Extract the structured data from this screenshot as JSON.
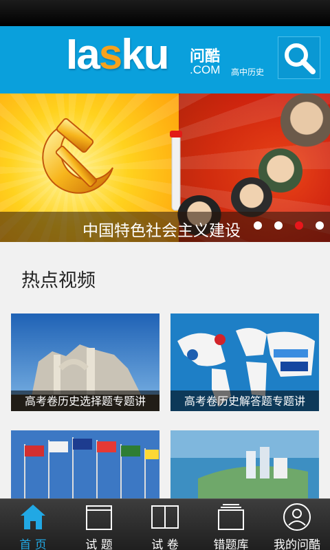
{
  "header": {
    "logo": {
      "main_a": "Ia",
      "main_q": "s",
      "main_b": "ku",
      "cn": "问酷",
      "com": ".COM",
      "subtitle": "高中历史"
    },
    "search_icon": "search-icon"
  },
  "banner": {
    "caption": "中国特色社会主义建设",
    "slide_count": 4,
    "active_slide_index": 2,
    "colors": {
      "dot_active": "#e8161b",
      "dot_inactive": "#ffffff"
    }
  },
  "section": {
    "title": "热点视频"
  },
  "videos": [
    {
      "caption": "高考卷历史选择题专题讲",
      "thumb": "ruins-image"
    },
    {
      "caption": "高考卷历史解答题专题讲",
      "thumb": "brand-world-map-image"
    },
    {
      "caption": "",
      "thumb": "flags-image"
    },
    {
      "caption": "",
      "thumb": "coastal-city-image"
    }
  ],
  "tabbar": {
    "items": [
      {
        "label": "首 页",
        "icon": "home-icon",
        "active": true
      },
      {
        "label": "试 题",
        "icon": "page-icon",
        "active": false
      },
      {
        "label": "试 卷",
        "icon": "book-icon",
        "active": false
      },
      {
        "label": "错题库",
        "icon": "stack-icon",
        "active": false
      },
      {
        "label": "我的问酷",
        "icon": "user-icon",
        "active": false
      }
    ]
  },
  "colors": {
    "header_bg": "#0aa0dc",
    "tab_active": "#21a8e4",
    "logo_accent": "#f6a21d"
  }
}
